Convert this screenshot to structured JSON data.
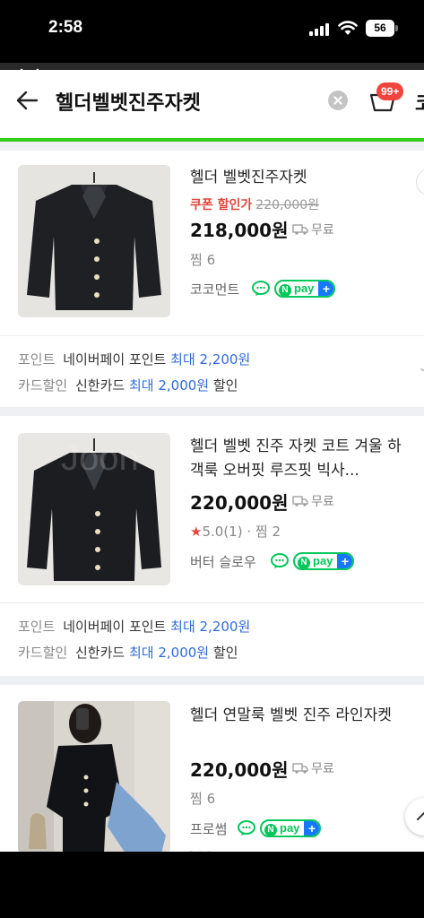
{
  "status": {
    "time": "2:58",
    "battery": "56"
  },
  "header": {
    "query": "헬더벨벳진주자켓",
    "cart_badge": "99+",
    "edge_text": "코"
  },
  "products": [
    {
      "title": "헬더 벨벳진주자켓",
      "coupon_label": "쿠폰 할인가",
      "original_price": "220,000원",
      "price": "218,000원",
      "shipping": "무료",
      "meta": "찜 6",
      "seller": "코코먼트",
      "npay": "pay",
      "benefit_point_label": "포인트",
      "benefit_point_text": "네이버페이 포인트",
      "benefit_point_value": "최대 2,200원",
      "benefit_card_label": "카드할인",
      "benefit_card_text": "신한카드",
      "benefit_card_value": "최대 2,000원",
      "benefit_card_suffix": "할인"
    },
    {
      "title": "헬더 벨벳 진주 자켓 코트 겨울 하객룩 오버핏 루즈핏 빅사...",
      "price": "220,000원",
      "shipping": "무료",
      "rating": "5.0",
      "rating_count": "(1)",
      "meta": "찜 2",
      "seller": "버터 슬로우",
      "npay": "pay",
      "watermark": "Joon",
      "benefit_point_label": "포인트",
      "benefit_point_text": "네이버페이 포인트",
      "benefit_point_value": "최대 2,200원",
      "benefit_card_label": "카드할인",
      "benefit_card_text": "신한카드",
      "benefit_card_value": "최대 2,000원",
      "benefit_card_suffix": "할인"
    },
    {
      "title": "헬더 연말룩 벨벳 진주 라인자켓",
      "price": "220,000원",
      "shipping": "무료",
      "meta": "찜 6",
      "seller": "프로썸",
      "npay": "pay"
    }
  ],
  "colors": {
    "accent_green": "#03c75a",
    "coupon_red": "#e3453a",
    "link_blue": "#2f6bd8",
    "badge_red": "#f0443c"
  }
}
